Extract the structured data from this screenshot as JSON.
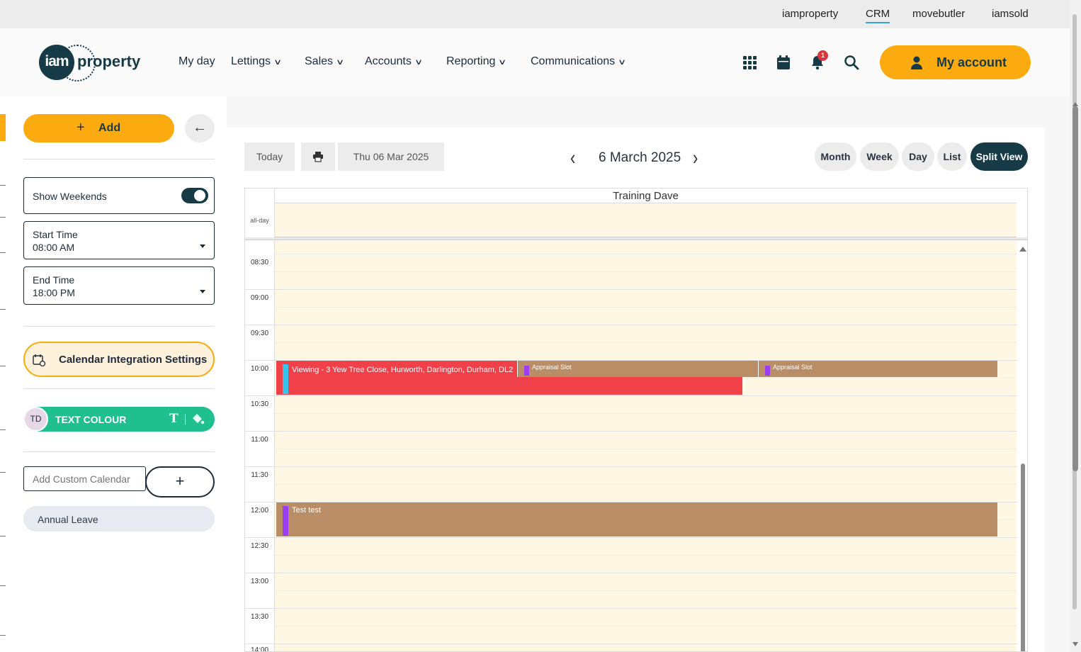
{
  "top_links": [
    "iamproperty",
    "CRM",
    "movebutler",
    "iamsold"
  ],
  "logo": {
    "badge": "iam",
    "word": "property"
  },
  "nav": {
    "my_day": "My day",
    "lettings": "Lettings",
    "sales": "Sales",
    "accounts": "Accounts",
    "reporting": "Reporting",
    "communications": "Communications"
  },
  "header": {
    "notification_count": "1",
    "my_account": "My account"
  },
  "sidebar": {
    "add": "Add",
    "show_weekends": "Show Weekends",
    "start_time_label": "Start Time",
    "start_time_value": "08:00 AM",
    "end_time_label": "End Time",
    "end_time_value": "18:00 PM",
    "calendar_integration": "Calendar Integration Settings",
    "user_initials": "TD",
    "text_colour": "TEXT COLOUR",
    "custom_calendar_placeholder": "Add Custom Calendar",
    "custom_add": "+",
    "annual_leave": "Annual Leave"
  },
  "toolbar": {
    "today": "Today",
    "date_field": "Thu 06 Mar 2025",
    "title": "6 March 2025",
    "views": [
      "Month",
      "Week",
      "Day",
      "List",
      "Split View"
    ],
    "active_view": "Split View"
  },
  "calendar": {
    "column": "Training Dave",
    "all_day": "all-day",
    "times": [
      "08:30",
      "09:00",
      "09:30",
      "10:00",
      "10:30",
      "11:00",
      "11:30",
      "12:00",
      "12:30",
      "13:00",
      "13:30",
      "14:00"
    ],
    "events": {
      "viewing": "Viewing - 3 Yew Tree Close, Hurworth, Darlington, Durham, DL2",
      "appraisal_1": "Appraisal Slot",
      "appraisal_2": "Appraisal Slot",
      "test": "Test test"
    },
    "colors": {
      "viewing": "#f0414a",
      "appraisal": "#b98d66",
      "slot_bg": "#fdf7e4",
      "accent": "#fbab0f",
      "primary": "#163a46"
    }
  }
}
